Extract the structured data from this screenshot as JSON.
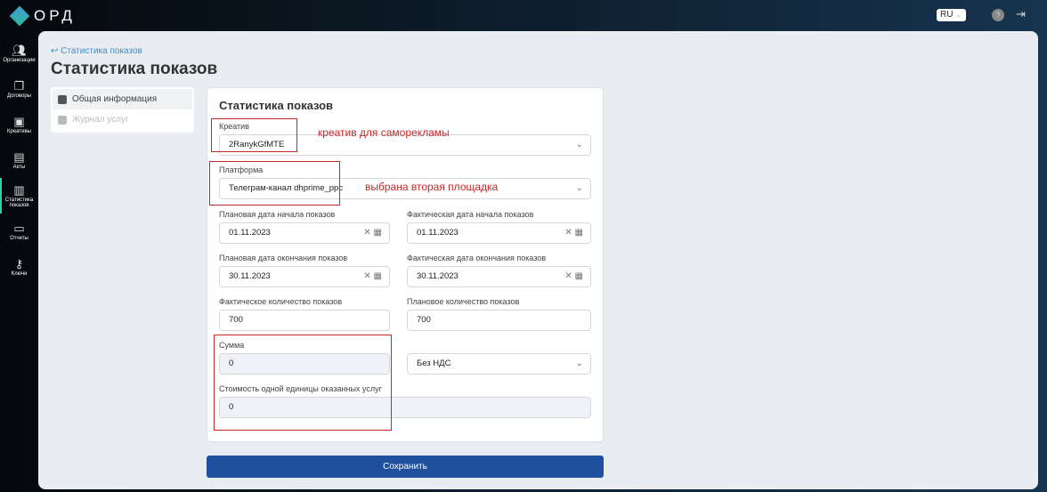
{
  "app": {
    "logo": "ОРД",
    "lang": "RU",
    "help": "?"
  },
  "sidebar": [
    {
      "label": "Организации",
      "icon": "users-icon"
    },
    {
      "label": "Договоры",
      "icon": "documents-icon"
    },
    {
      "label": "Креативы",
      "icon": "image-icon"
    },
    {
      "label": "Акты",
      "icon": "file-icon"
    },
    {
      "label": "Статистика показов",
      "icon": "chart-icon",
      "active": true
    },
    {
      "label": "Отчеты",
      "icon": "report-icon"
    },
    {
      "label": "Ключи",
      "icon": "key-icon"
    }
  ],
  "breadcrumb": "Статистика показов",
  "page_title": "Статистика показов",
  "left_menu": {
    "general": "Общая информация",
    "journal": "Журнал услуг"
  },
  "form": {
    "title": "Статистика показов",
    "creative_label": "Креатив",
    "creative_value": "2RanykGfMTE",
    "platform_label": "Платформа",
    "platform_value": "Телеграм-канал dhprime_ppc",
    "plan_start_label": "Плановая дата начала показов",
    "plan_start": "01.11.2023",
    "fact_start_label": "Фактическая дата начала показов",
    "fact_start": "01.11.2023",
    "plan_end_label": "Плановая дата окончания показов",
    "plan_end": "30.11.2023",
    "fact_end_label": "Фактическая дата окончания показов",
    "fact_end": "30.11.2023",
    "fact_count_label": "Фактическое количество показов",
    "fact_count": "700",
    "plan_count_label": "Плановое количество показов",
    "plan_count": "700",
    "sum_label": "Сумма",
    "sum": "0",
    "vat": "Без НДС",
    "unit_cost_label": "Стоимость одной единицы оказанных услуг",
    "unit_cost": "0",
    "save": "Сохранить"
  },
  "annotations": {
    "creative": "креатив для саморекламы",
    "platform": "выбрана вторая площадка"
  }
}
